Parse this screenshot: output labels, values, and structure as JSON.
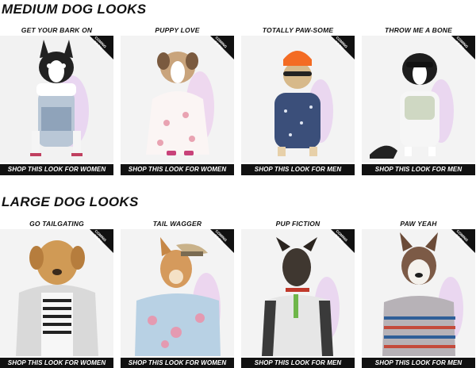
{
  "sections": [
    {
      "title": "MEDIUM DOG LOOKS",
      "looks": [
        {
          "name": "GET YOUR BARK ON",
          "badge": "COMING\nSOON",
          "button": "SHOP THIS LOOK FOR WOMEN"
        },
        {
          "name": "PUPPY LOVE",
          "badge": "COMING\nSOON",
          "button": "SHOP THIS LOOK FOR WOMEN"
        },
        {
          "name": "TOTALLY PAW-SOME",
          "badge": "COMING\nSOON",
          "button": "SHOP THIS LOOK FOR MEN"
        },
        {
          "name": "THROW ME A BONE",
          "badge": "COMING\nSOON",
          "button": "SHOP THIS LOOK FOR MEN"
        }
      ]
    },
    {
      "title": "LARGE DOG LOOKS",
      "looks": [
        {
          "name": "GO TAILGATING",
          "badge": "COMING\nSOON",
          "button": "SHOP THIS LOOK FOR WOMEN"
        },
        {
          "name": "TAIL WAGGER",
          "badge": "COMING\nSOON",
          "button": "SHOP THIS LOOK FOR WOMEN"
        },
        {
          "name": "PUP FICTION",
          "badge": "COMING\nSOON",
          "button": "SHOP THIS LOOK FOR MEN"
        },
        {
          "name": "PAW YEAH",
          "badge": "COMING\nSOON",
          "button": "SHOP THIS LOOK FOR MEN"
        }
      ]
    }
  ]
}
